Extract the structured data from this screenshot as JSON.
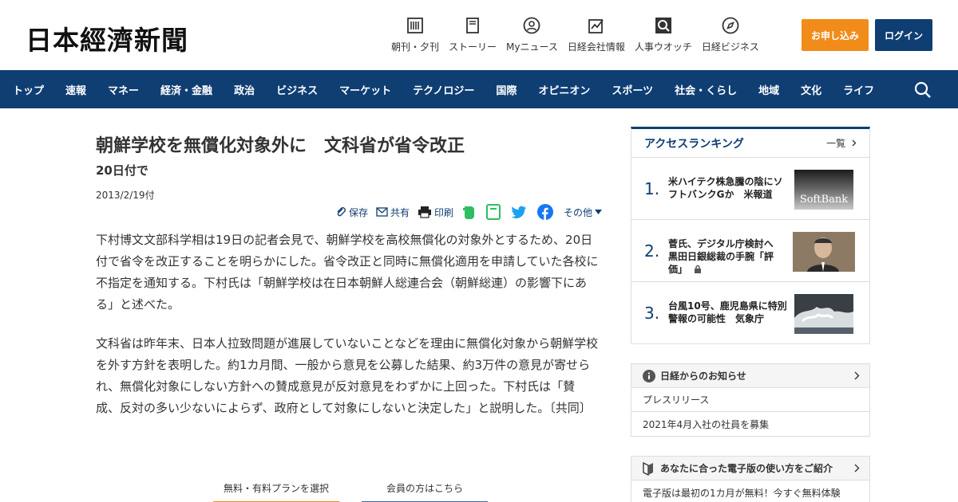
{
  "header": {
    "logo": "日本經濟新聞",
    "icons": [
      {
        "label": "朝刊・夕刊",
        "icon": "newspaper-icon"
      },
      {
        "label": "ストーリー",
        "icon": "book-icon"
      },
      {
        "label": "Myニュース",
        "icon": "user-icon"
      },
      {
        "label": "日経会社情報",
        "icon": "chart-icon"
      },
      {
        "label": "人事ウオッチ",
        "icon": "magnifier-icon"
      },
      {
        "label": "日経ビジネス",
        "icon": "compass-icon"
      }
    ],
    "apply_label": "お申し込み",
    "login_label": "ログイン"
  },
  "nav": {
    "items": [
      "トップ",
      "速報",
      "マネー",
      "経済・金融",
      "政治",
      "ビジネス",
      "マーケット",
      "テクノロジー",
      "国際",
      "オピニオン",
      "スポーツ",
      "社会・くらし",
      "地域",
      "文化",
      "ライフ"
    ]
  },
  "article": {
    "title": "朝鮮学校を無償化対象外に　文科省が省令改正",
    "subtitle": "20日付で",
    "date": "2013/2/19付",
    "share": {
      "save": "保存",
      "share": "共有",
      "print": "印刷",
      "more": "その他"
    },
    "paragraphs": [
      "下村博文文部科学相は19日の記者会見で、朝鮮学校を高校無償化の対象外とするため、20日付で省令を改正することを明らかにした。省令改正と同時に無償化適用を申請していた各校に不指定を通知する。下村氏は「朝鮮学校は在日本朝鮮人総連合会（朝鮮総連）の影響下にある」と述べた。",
      "文科省は昨年末、日本人拉致問題が進展していないことなどを理由に無償化対象から朝鮮学校を外す方針を表明した。約1カ月間、一般から意見を公募した結果、約3万件の意見が寄せられ、無償化対象にしない方針への賛成意見が反対意見をわずかに上回った。下村氏は「賛成、反対の多い少ないによらず、政府として対象にしないと決定した」と説明した。〔共同〕"
    ],
    "plan_tabs": [
      "無料・有料プランを選択",
      "会員の方はこちら"
    ]
  },
  "ranking": {
    "title": "アクセスランキング",
    "more": "一覧",
    "items": [
      {
        "num": "1.",
        "text": "米ハイテク株急騰の陰にソフトバンクGか　米報道",
        "img_text": "SoftBank"
      },
      {
        "num": "2.",
        "text": "菅氏、デジタル庁検討へ　黒田日銀総裁の手腕「評価」",
        "img_text": ""
      },
      {
        "num": "3.",
        "text": "台風10号、鹿児島県に特別警報の可能性　気象庁",
        "img_text": ""
      }
    ]
  },
  "notice": {
    "title": "日経からのお知らせ",
    "items": [
      "プレスリリース",
      "2021年4月入社の社員を募集"
    ]
  },
  "guide": {
    "title": "あなたに合った電子版の使い方をご紹介",
    "item": "電子版は最初の1カ月が無料！今すぐ無料体験"
  },
  "colors": {
    "navy": "#0f3e73",
    "orange": "#f18c1b",
    "evernote_green": "#2dbe60",
    "twitter_blue": "#1da1f2",
    "facebook_blue": "#1877f2"
  }
}
